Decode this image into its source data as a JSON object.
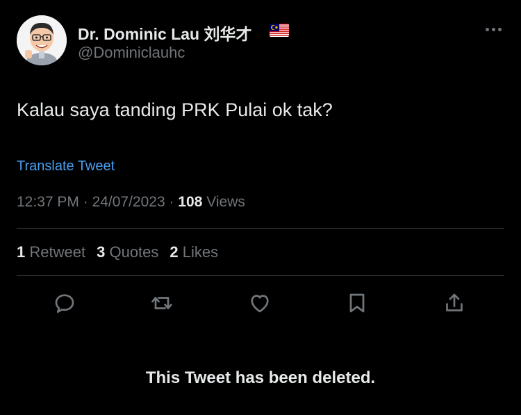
{
  "author": {
    "display_name": "Dr. Dominic Lau 刘华才",
    "handle": "@Dominiclauhc",
    "avatar_icon": "caricature-avatar",
    "flag_icon": "malaysia-flag-icon"
  },
  "tweet": {
    "text": "Kalau saya tanding PRK Pulai ok tak?",
    "translate_label": "Translate Tweet",
    "time": "12:37 PM",
    "date": "24/07/2023",
    "views_count": "108",
    "views_label": "Views"
  },
  "stats": {
    "retweets_count": "1",
    "retweets_label": "Retweet",
    "quotes_count": "3",
    "quotes_label": "Quotes",
    "likes_count": "2",
    "likes_label": "Likes"
  },
  "actions": {
    "reply_icon": "reply-icon",
    "retweet_icon": "retweet-icon",
    "like_icon": "heart-icon",
    "bookmark_icon": "bookmark-icon",
    "share_icon": "share-icon"
  },
  "deleted_notice": "This Tweet has been deleted.",
  "colors": {
    "background": "#000000",
    "primary_text": "#e7e9ea",
    "secondary_text": "#71767b",
    "link": "#4a9eef",
    "divider": "#2f3336"
  }
}
